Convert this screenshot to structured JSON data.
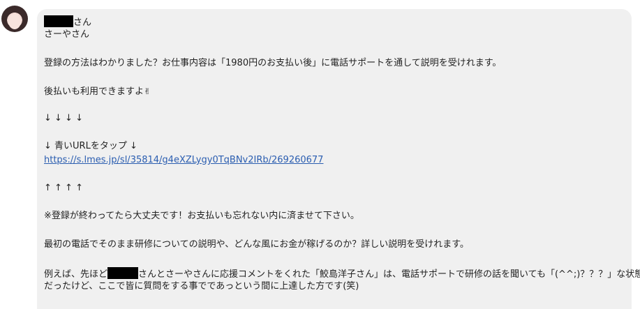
{
  "message": {
    "line1_suffix": "さん",
    "line2": "さーやさん",
    "line3": "登録の方法はわかりました？お仕事内容は「1980円のお支払い後」に電話サポートを通して説明を受けれます。",
    "line4_text": "後払いも利用できますよ",
    "line4_emoji": "✌",
    "arrows_down": "↓ ↓ ↓ ↓",
    "tap_label": "↓ 青いURLをタップ ↓",
    "url": "https://s.lmes.jp/sl/35814/g4eXZLygy0TqBNv2IRb/269260677",
    "arrows_up": "↑ ↑ ↑ ↑",
    "note": "※登録が終わってたら大丈夫です！お支払いも忘れない内に済ませて下さい。",
    "explain": "最初の電話でそのまま研修についての説明や、どんな風にお金が稼げるのか？詳しい説明を受けれます。",
    "example_prefix": "例えば、先ほど",
    "example_rest": "さんとさーやさんに応援コメントをくれた「鮫島洋子さん」は、電話サポートで研修の話を聞いても「(^^;)？？？」な状態",
    "example_line2": "だったけど、ここで皆に質問をする事でであっという間に上達した方です(笑)"
  },
  "colors": {
    "bubble": "#f0f0f0",
    "link": "#2a5db0",
    "text": "#222222"
  },
  "icons": {
    "avatar": "user-avatar-photo",
    "emoji": "victory-hand-emoji"
  }
}
